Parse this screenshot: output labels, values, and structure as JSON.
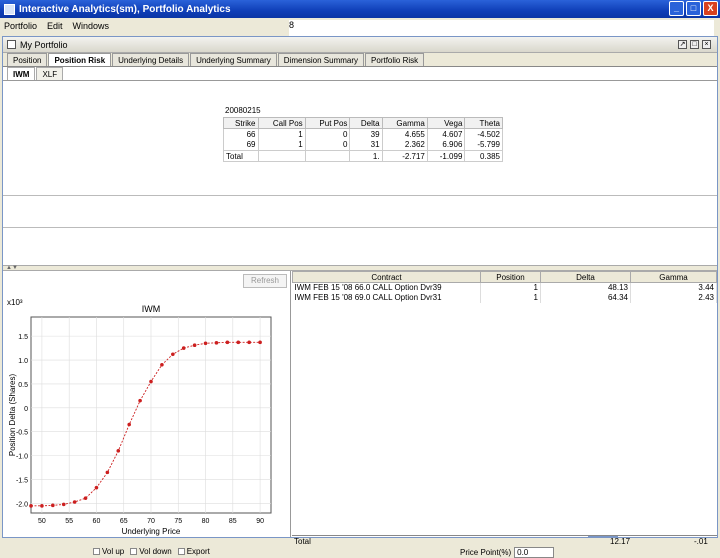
{
  "window": {
    "title": "Interactive Analytics(sm), Portfolio Analytics",
    "buttons": [
      "_",
      "□",
      "X"
    ]
  },
  "menu": [
    "Portfolio",
    "Edit",
    "Windows"
  ],
  "menu_right": "8",
  "panel": {
    "title": "My Portfolio",
    "controls": [
      "↗",
      "□",
      "×"
    ]
  },
  "tabs": [
    "Position",
    "Position Risk",
    "Underlying Details",
    "Underlying Summary",
    "Dimension Summary",
    "Portfolio Risk"
  ],
  "subtabs": [
    "IWM",
    "XLF"
  ],
  "summary": {
    "date": "20080215",
    "headers": [
      "Strike",
      "Call Pos",
      "Put Pos",
      "Delta",
      "Gamma",
      "Vega",
      "Theta"
    ],
    "rows": [
      [
        "66",
        "1",
        "0",
        "39",
        "4.655",
        "4.607",
        "-4.502"
      ],
      [
        "69",
        "1",
        "0",
        "31",
        "2.362",
        "6.906",
        "-5.799"
      ]
    ],
    "total": [
      "Total",
      "",
      "",
      "1.",
      "-2.717",
      "-1.099",
      "0.385"
    ]
  },
  "refresh_label": "Refresh",
  "chart_data": {
    "type": "line",
    "title": "IWM",
    "exponent": "x10³",
    "xlabel": "Underlying Price",
    "ylabel": "Position Delta (Shares)",
    "x_ticks": [
      "50",
      "55",
      "60",
      "65",
      "70",
      "75",
      "80",
      "85",
      "90"
    ],
    "y_ticks": [
      "1.5",
      "1.0",
      "0.5",
      "0",
      "-0.5",
      "-1.0",
      "-1.5",
      "-2.0"
    ],
    "xlim": [
      48,
      92
    ],
    "ylim": [
      -2.2,
      1.9
    ],
    "series": [
      {
        "name": "",
        "color": "#cc1f1f",
        "x": [
          48,
          50,
          52,
          54,
          56,
          58,
          60,
          62,
          64,
          66,
          68,
          70,
          72,
          74,
          76,
          78,
          80,
          82,
          84,
          86,
          88,
          90
        ],
        "y": [
          -2.05,
          -2.05,
          -2.04,
          -2.02,
          -1.97,
          -1.89,
          -1.67,
          -1.35,
          -0.9,
          -0.35,
          0.15,
          0.55,
          0.9,
          1.12,
          1.25,
          1.31,
          1.35,
          1.36,
          1.37,
          1.37,
          1.37,
          1.37
        ]
      }
    ],
    "legend": [
      "Vol up",
      "Vol down",
      "Export"
    ]
  },
  "risk_table": {
    "headers": [
      "Contract",
      "Position",
      "Delta",
      "Gamma"
    ],
    "rows": [
      [
        "IWM FEB 15 '08 66.0 CALL Option Dvr39",
        "1",
        "48.13",
        "3.44"
      ],
      [
        "IWM FEB 15 '08 69.0 CALL Option Dvr31",
        "1",
        "64.34",
        "2.43"
      ]
    ],
    "total_label": "Total",
    "total_delta": "12.17",
    "total_gamma": "-.01"
  },
  "price_point": {
    "label": "Price Point(%)",
    "value": "0.0"
  }
}
